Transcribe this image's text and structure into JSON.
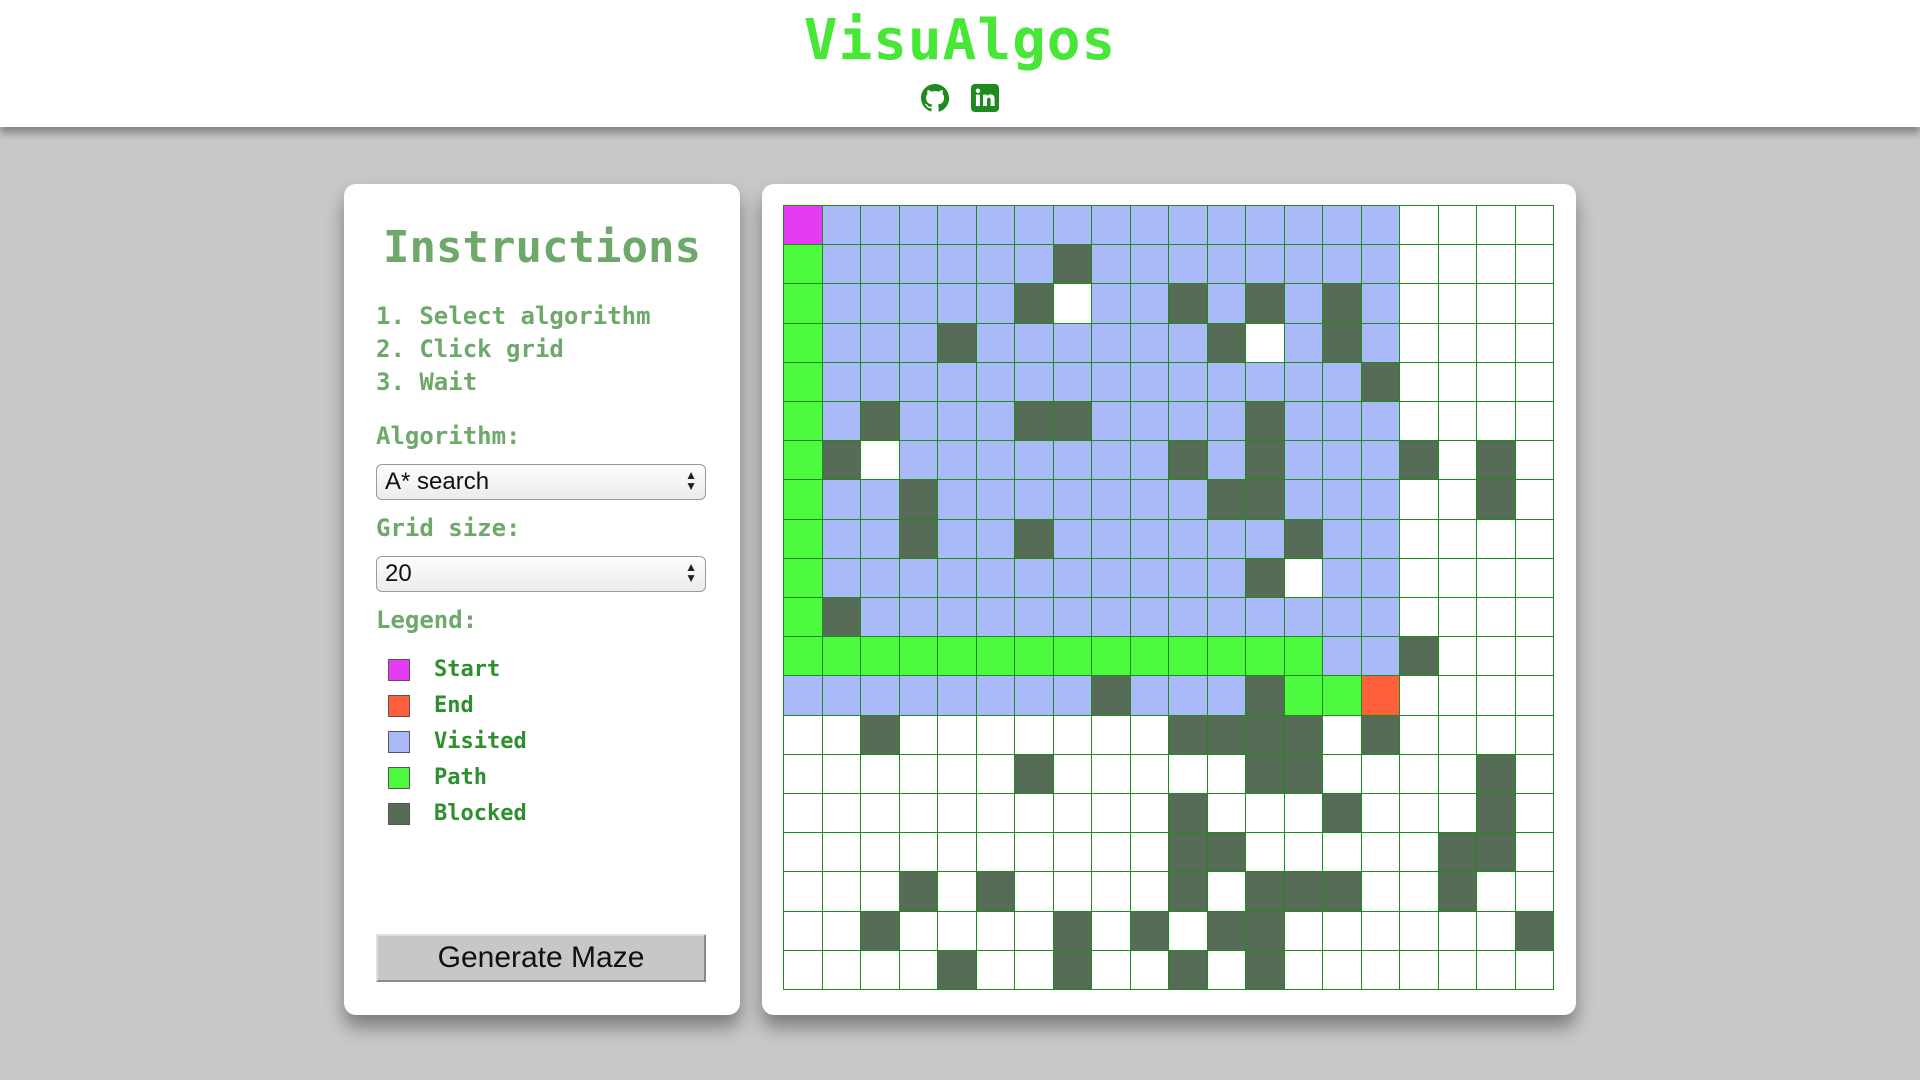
{
  "header": {
    "title": "VisuAlgos",
    "icons": [
      "github-icon",
      "linkedin-icon"
    ]
  },
  "instructions": {
    "title": "Instructions",
    "steps": [
      "1. Select algorithm",
      "2. Click grid",
      "3. Wait"
    ],
    "algorithm_label": "Algorithm:",
    "algorithm_value": "A* search",
    "grid_size_label": "Grid size:",
    "grid_size_value": "20",
    "legend_label": "Legend:",
    "legend": [
      {
        "label": "Start",
        "color": "#e53cf2"
      },
      {
        "label": "End",
        "color": "#ff5f3a"
      },
      {
        "label": "Visited",
        "color": "#aabaf8"
      },
      {
        "label": "Path",
        "color": "#4dfa3f"
      },
      {
        "label": "Blocked",
        "color": "#576c56"
      }
    ],
    "generate_button": "Generate Maze"
  },
  "grid": {
    "size": 20,
    "legend_key": {
      "S": "start",
      "E": "end",
      "V": "visited",
      "P": "path",
      "B": "blocked",
      ".": "empty"
    },
    "rows": [
      "SVVVVVVVVVVVVVVV....",
      "PVVVVVVBVVVVVVVV....",
      "PVVVVVB.VVBVBVBV....",
      "PVVVBVVVVVVB.VBV....",
      "PVVVVVVVVVVVVVVB....",
      "PVBVVVBBVVVVBVVV....",
      "PB.VVVVVVVBVBVVVB.B.",
      "PVVBVVVVVVVBBVVV..B.",
      "PVVBVVBVVVVVVBVV....",
      "PVVVVVVVVVVVB.VV....",
      "PBVVVVVVVVVVVVVV....",
      "PPPPPPPPPPPPPPVVB...",
      "VVVVVVVVBVVVBPPE....",
      "..B.......BBBB.B....",
      "......B.....BB....B.",
      "..........B...B...B.",
      "..........BB.....BB.",
      "...B.B....B.BBB..B..",
      "..B....B.B.BB......B",
      "....B..B..B.B......."
    ]
  }
}
